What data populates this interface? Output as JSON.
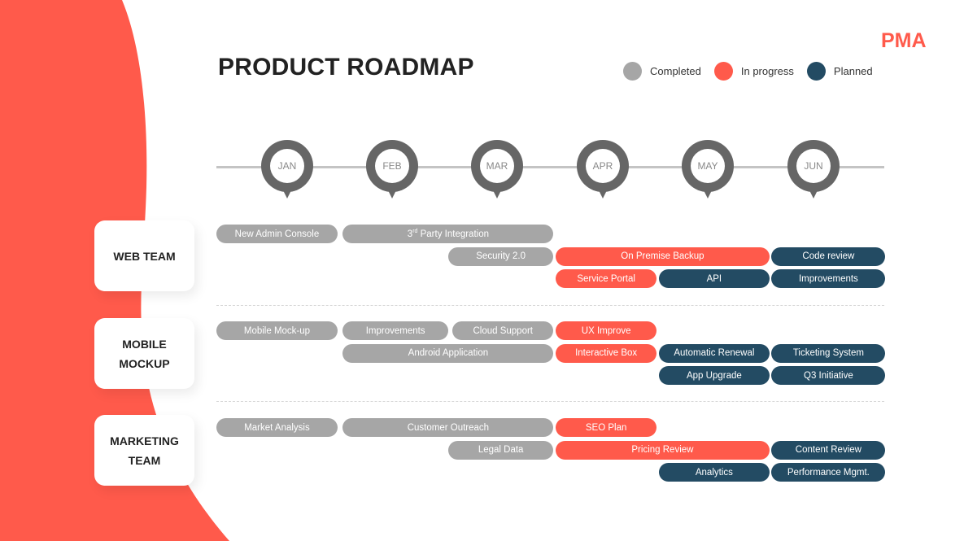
{
  "brand": {
    "logo_text": "PMA",
    "accent": "#ff5a4b"
  },
  "title": "PRODUCT ROADMAP",
  "legend": [
    {
      "label": "Completed",
      "status": "completed",
      "color": "#a6a6a6"
    },
    {
      "label": "In progress",
      "status": "in_progress",
      "color": "#ff5a4b"
    },
    {
      "label": "Planned",
      "status": "planned",
      "color": "#234b63"
    }
  ],
  "colors": {
    "completed": "#a6a6a6",
    "in_progress": "#ff5a4b",
    "planned": "#234b63",
    "pin": "#666666"
  },
  "months": [
    "JAN",
    "FEB",
    "MAR",
    "APR",
    "MAY",
    "JUN"
  ],
  "teams": [
    {
      "name": "WEB TEAM",
      "lines": [
        "WEB TEAM"
      ],
      "tasks": [
        {
          "label": "New Admin Console",
          "status": "completed",
          "start": 0,
          "end": 1.15,
          "row": 0
        },
        {
          "label": "3rd Party Integration",
          "status": "completed",
          "start": 1.2,
          "end": 3.2,
          "row": 0,
          "sup": "rd",
          "pre": "3",
          "post": " Party Integration"
        },
        {
          "label": "Security 2.0",
          "status": "completed",
          "start": 2.2,
          "end": 3.2,
          "row": 1
        },
        {
          "label": "On Premise Backup",
          "status": "in_progress",
          "start": 3.22,
          "end": 5.25,
          "row": 1
        },
        {
          "label": "Code review",
          "status": "planned",
          "start": 5.27,
          "end": 6.35,
          "row": 1
        },
        {
          "label": "Service Portal",
          "status": "in_progress",
          "start": 3.22,
          "end": 4.18,
          "row": 2
        },
        {
          "label": "API",
          "status": "planned",
          "start": 4.2,
          "end": 5.25,
          "row": 2
        },
        {
          "label": "Improvements",
          "status": "planned",
          "start": 5.27,
          "end": 6.35,
          "row": 2
        }
      ]
    },
    {
      "name": "MOBILE MOCKUP",
      "lines": [
        "MOBILE",
        "MOCKUP"
      ],
      "tasks": [
        {
          "label": "Mobile Mock-up",
          "status": "completed",
          "start": 0,
          "end": 1.15,
          "row": 0
        },
        {
          "label": "Improvements",
          "status": "completed",
          "start": 1.2,
          "end": 2.2,
          "row": 0
        },
        {
          "label": "Cloud Support",
          "status": "completed",
          "start": 2.24,
          "end": 3.2,
          "row": 0
        },
        {
          "label": "UX Improve",
          "status": "in_progress",
          "start": 3.22,
          "end": 4.18,
          "row": 0
        },
        {
          "label": "Android Application",
          "status": "completed",
          "start": 1.2,
          "end": 3.2,
          "row": 1
        },
        {
          "label": "Interactive Box",
          "status": "in_progress",
          "start": 3.22,
          "end": 4.18,
          "row": 1
        },
        {
          "label": "Automatic Renewal",
          "status": "planned",
          "start": 4.2,
          "end": 5.25,
          "row": 1
        },
        {
          "label": "Ticketing System",
          "status": "planned",
          "start": 5.27,
          "end": 6.35,
          "row": 1
        },
        {
          "label": "App Upgrade",
          "status": "planned",
          "start": 4.2,
          "end": 5.25,
          "row": 2
        },
        {
          "label": "Q3 Initiative",
          "status": "planned",
          "start": 5.27,
          "end": 6.35,
          "row": 2
        }
      ]
    },
    {
      "name": "MARKETING TEAM",
      "lines": [
        "MARKETING",
        "TEAM"
      ],
      "tasks": [
        {
          "label": "Market Analysis",
          "status": "completed",
          "start": 0,
          "end": 1.15,
          "row": 0
        },
        {
          "label": "Customer Outreach",
          "status": "completed",
          "start": 1.2,
          "end": 3.2,
          "row": 0
        },
        {
          "label": "SEO Plan",
          "status": "in_progress",
          "start": 3.22,
          "end": 4.18,
          "row": 0
        },
        {
          "label": "Legal Data",
          "status": "completed",
          "start": 2.2,
          "end": 3.2,
          "row": 1
        },
        {
          "label": "Pricing Review",
          "status": "in_progress",
          "start": 3.22,
          "end": 5.25,
          "row": 1
        },
        {
          "label": "Content Review",
          "status": "planned",
          "start": 5.27,
          "end": 6.35,
          "row": 1
        },
        {
          "label": "Analytics",
          "status": "planned",
          "start": 4.2,
          "end": 5.25,
          "row": 2
        },
        {
          "label": "Performance Mgmt.",
          "status": "planned",
          "start": 5.27,
          "end": 6.35,
          "row": 2
        }
      ]
    }
  ]
}
